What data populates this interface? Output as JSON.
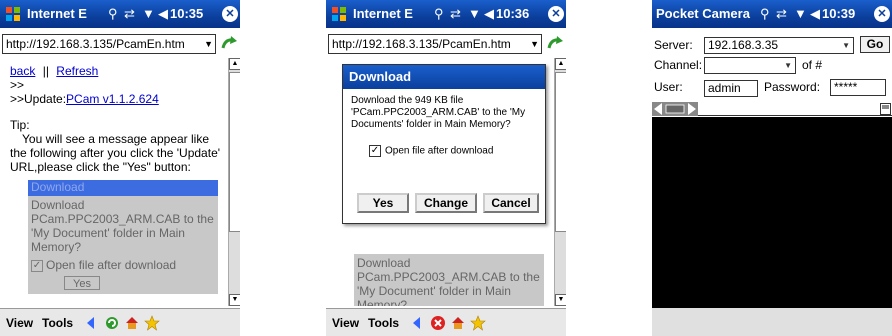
{
  "screen1": {
    "title": "Internet E",
    "time": "10:35",
    "close": "✕",
    "address": "http://192.168.3.135/PcamEn.htm",
    "links": {
      "back": "back",
      "separator": "||",
      "refresh": "Refresh"
    },
    "line1": ">>",
    "update_prefix": ">>Update:",
    "update_link": "PCam v1.1.2.624",
    "tip_label": "Tip:",
    "tip_text": "You will see a message appear like the following after you click the 'Update' URL,please click the \"Yes\" button:",
    "embed": {
      "title": "Download",
      "message": "Download PCam.PPC2003_ARM.CAB to the 'My Document' folder in Main Memory?",
      "checkbox": "Open file after download",
      "button": "Yes"
    },
    "menu": {
      "view": "View",
      "tools": "Tools"
    }
  },
  "screen2": {
    "title": "Internet E",
    "time": "10:36",
    "close": "✕",
    "address": "http://192.168.3.135/PcamEn.htm",
    "dialog": {
      "title": "Download",
      "message": "Download the 949 KB file 'PCam.PPC2003_ARM.CAB' to the 'My Documents' folder in Main Memory?",
      "checkbox": "Open file after download",
      "buttons": {
        "yes": "Yes",
        "change": "Change",
        "cancel": "Cancel"
      }
    },
    "menu": {
      "view": "View",
      "tools": "Tools"
    }
  },
  "screen3": {
    "title": "Pocket Camera",
    "time": "10:39",
    "close": "✕",
    "server_label": "Server:",
    "server_value": "192.168.3.35",
    "go": "Go",
    "channel_label": "Channel:",
    "channel_value": "",
    "of_label": "of #",
    "user_label": "User:",
    "user_value": "admin",
    "password_label": "Password:",
    "password_value": "*****"
  },
  "icon_names": [
    "windows-flag-icon",
    "signal-icon",
    "sync-icon",
    "antenna-icon",
    "volume-icon",
    "close-icon",
    "go-arrow-icon",
    "back-arrow-icon",
    "stop-icon",
    "home-icon",
    "favorites-icon"
  ]
}
